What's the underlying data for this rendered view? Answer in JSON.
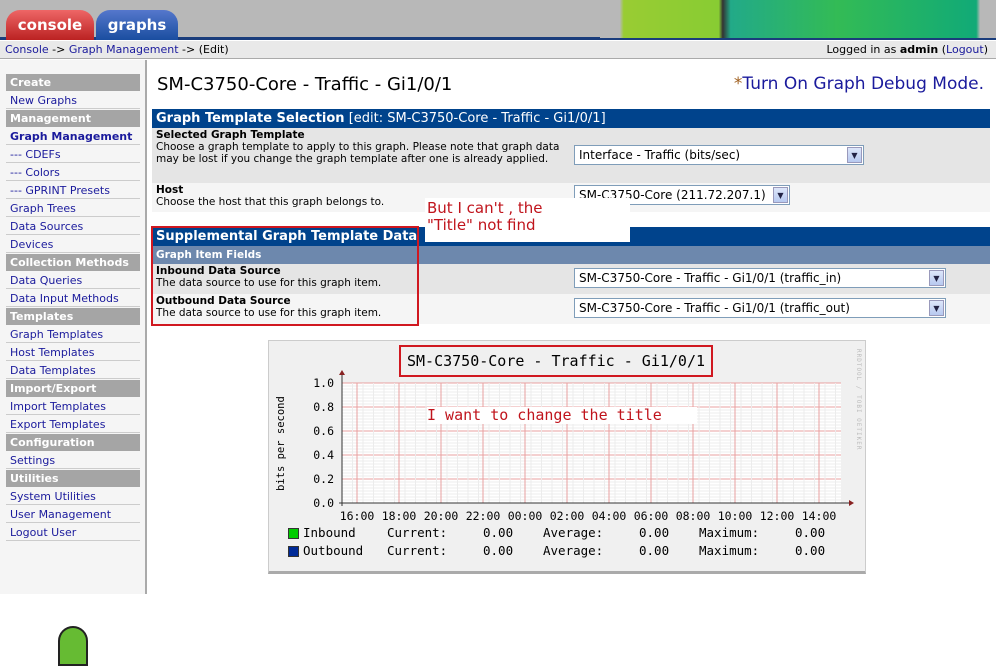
{
  "tabs": [
    {
      "label": "console",
      "color": "#cc3333"
    },
    {
      "label": "graphs",
      "color": "#1a4ea0"
    }
  ],
  "breadcrumb": {
    "console": "Console",
    "sep1": " -> ",
    "graph_management": "Graph Management",
    "sep2": " -> ",
    "current": "(Edit)"
  },
  "login": {
    "prefix": "Logged in as ",
    "user": "admin",
    "open": " (",
    "logout": "Logout",
    "close": ")"
  },
  "sidebar": [
    {
      "type": "header",
      "label": "Create"
    },
    {
      "type": "item",
      "label": "New Graphs"
    },
    {
      "type": "header",
      "label": "Management"
    },
    {
      "type": "item",
      "label": "Graph Management",
      "active": true
    },
    {
      "type": "item",
      "label": "--- CDEFs"
    },
    {
      "type": "item",
      "label": "--- Colors"
    },
    {
      "type": "item",
      "label": "--- GPRINT Presets"
    },
    {
      "type": "item",
      "label": "Graph Trees"
    },
    {
      "type": "item",
      "label": "Data Sources"
    },
    {
      "type": "item",
      "label": "Devices"
    },
    {
      "type": "header",
      "label": "Collection Methods"
    },
    {
      "type": "item",
      "label": "Data Queries"
    },
    {
      "type": "item",
      "label": "Data Input Methods"
    },
    {
      "type": "header",
      "label": "Templates"
    },
    {
      "type": "item",
      "label": "Graph Templates"
    },
    {
      "type": "item",
      "label": "Host Templates"
    },
    {
      "type": "item",
      "label": "Data Templates"
    },
    {
      "type": "header",
      "label": "Import/Export"
    },
    {
      "type": "item",
      "label": "Import Templates"
    },
    {
      "type": "item",
      "label": "Export Templates"
    },
    {
      "type": "header",
      "label": "Configuration"
    },
    {
      "type": "item",
      "label": "Settings"
    },
    {
      "type": "header",
      "label": "Utilities"
    },
    {
      "type": "item",
      "label": "System Utilities"
    },
    {
      "type": "item",
      "label": "User Management"
    },
    {
      "type": "item",
      "label": "Logout User"
    }
  ],
  "page": {
    "title": "SM-C3750-Core - Traffic - Gi1/0/1",
    "debug_star": "*",
    "debug_link": "Turn On Graph Debug Mode."
  },
  "template_selection": {
    "header": "Graph Template Selection",
    "header_edit": " [edit: SM-C3750-Core - Traffic - Gi1/0/1]",
    "template_label": "Selected Graph Template",
    "template_desc": "Choose a graph template to apply to this graph. Please note that graph data may be lost if you change the graph template after one is already applied.",
    "template_value": "Interface - Traffic (bits/sec)",
    "host_label": "Host",
    "host_desc": "Choose the host that this graph belongs to.",
    "host_value": "SM-C3750-Core (211.72.207.1)"
  },
  "supplemental": {
    "header": "Supplemental Graph Template Data",
    "subheader": "Graph Item Fields",
    "inbound_label": "Inbound Data Source",
    "inbound_desc": "The data source to use for this graph item.",
    "inbound_value": "SM-C3750-Core - Traffic - Gi1/0/1 (traffic_in)",
    "outbound_label": "Outbound Data Source",
    "outbound_desc": "The data source to use for this graph item.",
    "outbound_value": "SM-C3750-Core - Traffic - Gi1/0/1 (traffic_out)"
  },
  "annotations": {
    "note1_line1": "But I can't , the",
    "note1_line2": "\"Title\" not find",
    "note2": "I want to change the title"
  },
  "graph": {
    "title": "SM-C3750-Core - Traffic - Gi1/0/1",
    "watermark": "RRDTOOL / TOBI OETIKER",
    "ylabel": "bits per second",
    "legend": [
      {
        "name": "Inbound",
        "color": "#00cc00",
        "current_label": "Current:",
        "current": "0.00",
        "average_label": "Average:",
        "average": "0.00",
        "maximum_label": "Maximum:",
        "maximum": "0.00"
      },
      {
        "name": "Outbound",
        "color": "#002a97",
        "current_label": "Current:",
        "current": "0.00",
        "average_label": "Average:",
        "average": "0.00",
        "maximum_label": "Maximum:",
        "maximum": "0.00"
      }
    ]
  },
  "chart_data": {
    "type": "line",
    "ylabel": "bits per second",
    "ylim": [
      0,
      1.0
    ],
    "y_ticks": [
      "0.0",
      "0.2",
      "0.4",
      "0.6",
      "0.8",
      "1.0"
    ],
    "x_ticks": [
      "16:00",
      "18:00",
      "20:00",
      "22:00",
      "00:00",
      "02:00",
      "04:00",
      "06:00",
      "08:00",
      "10:00",
      "12:00",
      "14:00"
    ],
    "grid": true,
    "series": [
      {
        "name": "Inbound",
        "values": []
      },
      {
        "name": "Outbound",
        "values": []
      }
    ]
  }
}
